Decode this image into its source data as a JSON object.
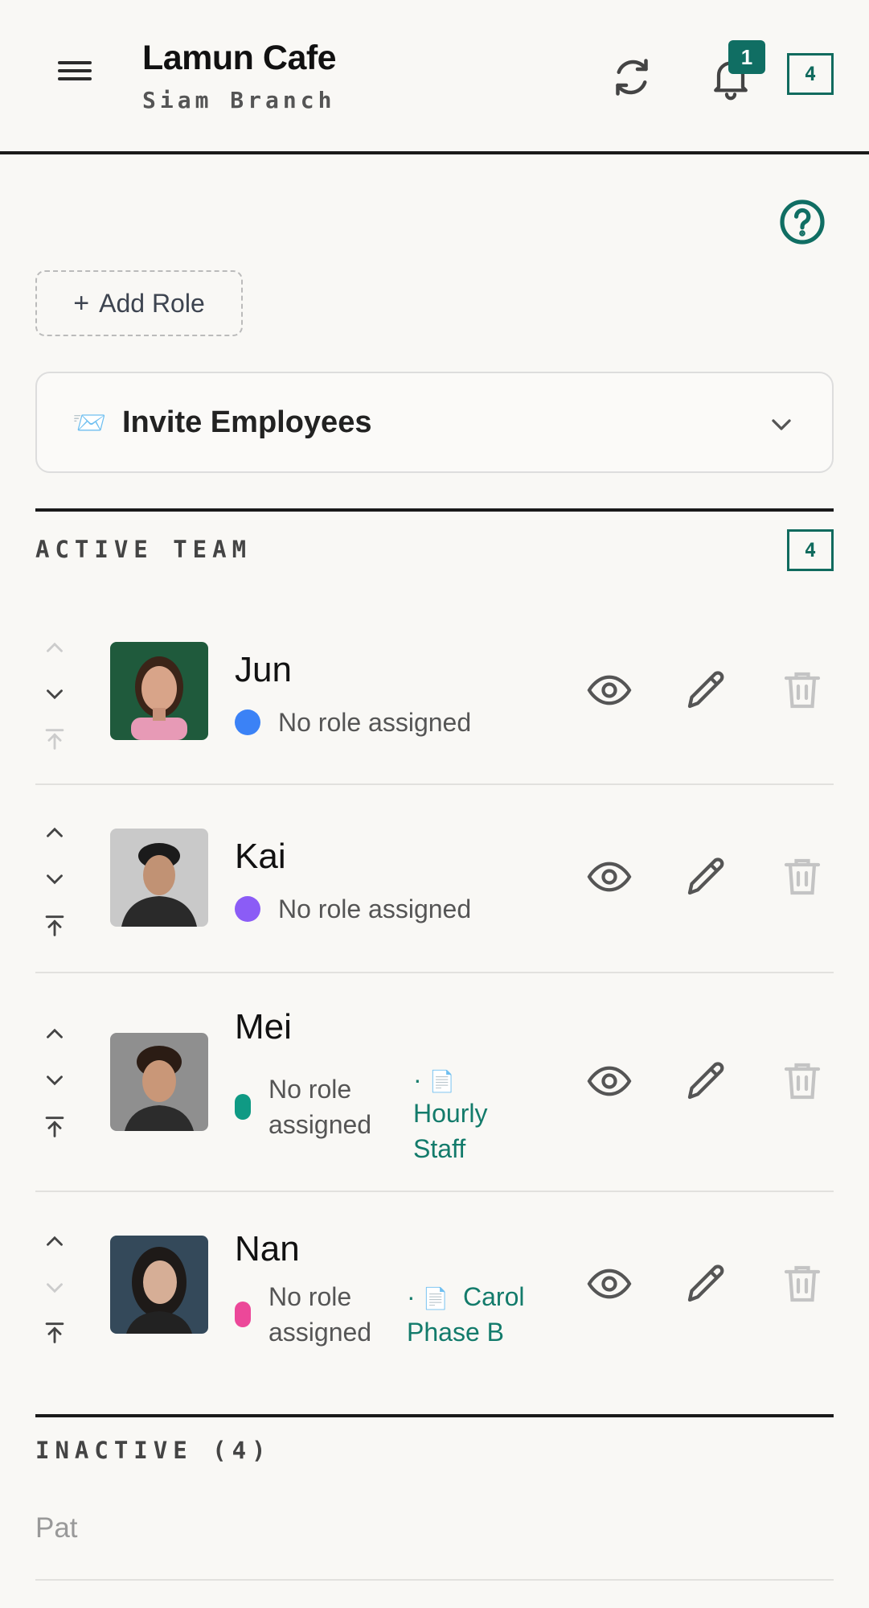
{
  "header": {
    "title": "Lamun Cafe",
    "subtitle": "Siam Branch",
    "notification_count": "1",
    "team_count": "4",
    "icons": [
      "menu-icon",
      "refresh-icon",
      "bell-icon"
    ]
  },
  "toolbar": {
    "add_role_label": "Add Role",
    "help_icon": "question-circle-icon"
  },
  "invite": {
    "label": "Invite Employees",
    "icon": "📨"
  },
  "active_section": {
    "title": "ACTIVE TEAM",
    "count": "4"
  },
  "members": [
    {
      "name": "Jun",
      "role": "No role assigned",
      "role_color": "#3b82f6",
      "note": ""
    },
    {
      "name": "Kai",
      "role": "No role assigned",
      "role_color": "#8b5cf6",
      "note": ""
    },
    {
      "name": "Mei",
      "role": "No role assigned",
      "role_color": "#0f9a84",
      "note": "Hourly Staff"
    },
    {
      "name": "Nan",
      "role": "No role assigned",
      "role_color": "#ec4899",
      "note": "Carol Phase B"
    }
  ],
  "inactive_section": {
    "title": "INACTIVE (4)",
    "items": [
      "Pat"
    ]
  },
  "colors": {
    "accent": "#106e63",
    "background": "#f9f8f5"
  }
}
